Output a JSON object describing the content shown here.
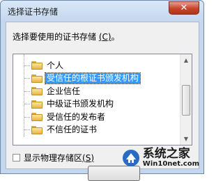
{
  "window": {
    "title": "选择证书存储",
    "close_label": "✕"
  },
  "prompt": {
    "text_before": "选择要使用的证书存储 ",
    "accel": "(C)",
    "text_after": "。"
  },
  "tree": {
    "items": [
      {
        "label": "个人",
        "selected": false,
        "icon": "folder-icon"
      },
      {
        "label": "受信任的根证书颁发机构",
        "selected": true,
        "icon": "folder-icon"
      },
      {
        "label": "企业信任",
        "selected": false,
        "icon": "folder-icon"
      },
      {
        "label": "中级证书颁发机构",
        "selected": false,
        "icon": "folder-icon"
      },
      {
        "label": "受信任的发布者",
        "selected": false,
        "icon": "folder-icon"
      },
      {
        "label": "不信任的证书",
        "selected": false,
        "icon": "folder-icon"
      }
    ],
    "scroll_up_icon": "▲",
    "scroll_down_icon": "▼"
  },
  "checkbox": {
    "label_before": "显示物理存储区",
    "accel": "(S)",
    "checked": false
  },
  "watermark": {
    "main": "系统之家",
    "url": "Win10net.com"
  },
  "colors": {
    "selection": "#3399ff",
    "close_button": "#c7432a",
    "frame": "#c5d7ee"
  }
}
